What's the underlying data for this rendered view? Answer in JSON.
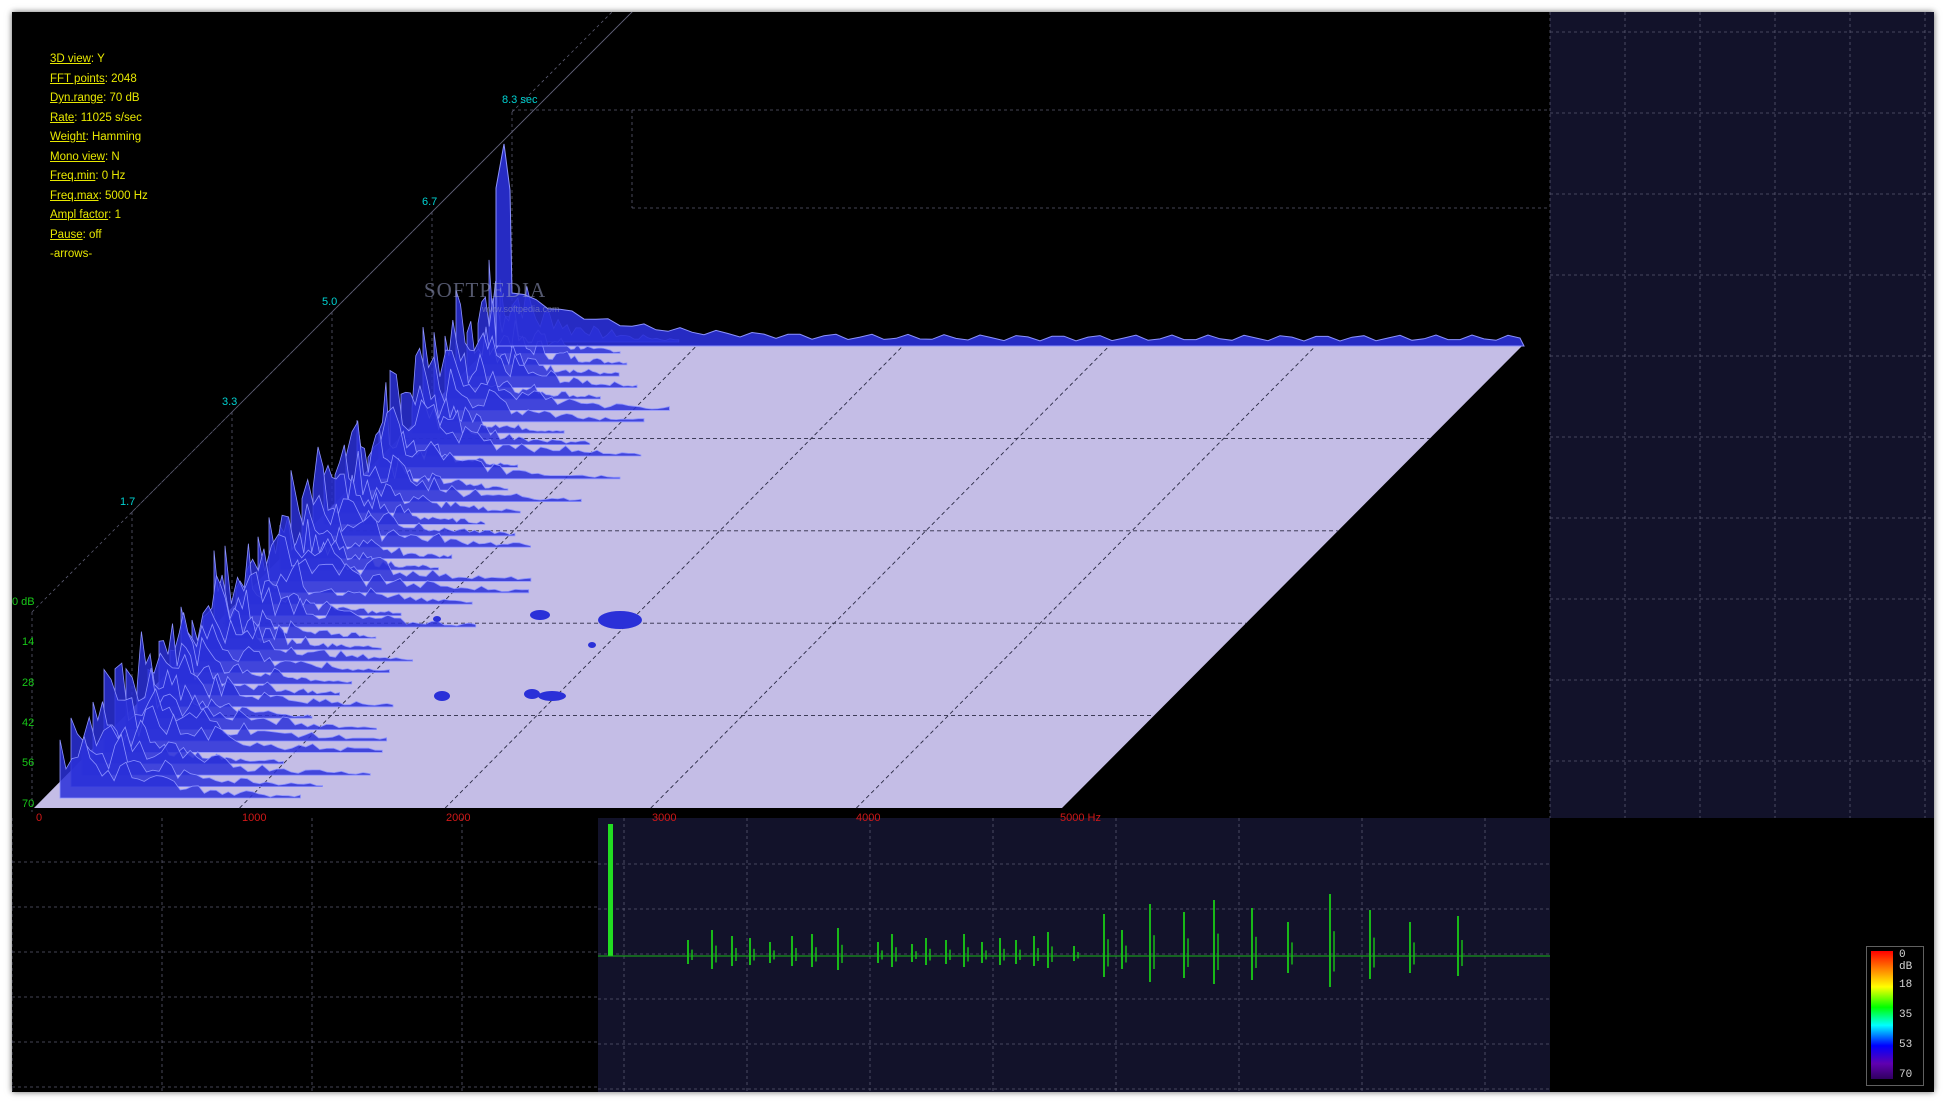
{
  "settings": [
    {
      "key": "3D view",
      "value": "Y"
    },
    {
      "key": "FFT points",
      "value": "2048"
    },
    {
      "key": "Dyn.range",
      "value": "70 dB"
    },
    {
      "key": "Rate",
      "value": "11025 s/sec"
    },
    {
      "key": "Weight",
      "value": "Hamming"
    },
    {
      "key": "Mono view",
      "value": "N"
    },
    {
      "key": "Freq.min",
      "value": "0 Hz"
    },
    {
      "key": "Freq.max",
      "value": "5000 Hz"
    },
    {
      "key": "Ampl factor",
      "value": "1"
    },
    {
      "key": "Pause",
      "value": "off"
    }
  ],
  "hint": "-arrows-",
  "time_axis": [
    "1.7",
    "3.3",
    "5.0",
    "6.7",
    "8.3 sec"
  ],
  "db_axis": [
    "0 dB",
    "14",
    "28",
    "42",
    "56",
    "70"
  ],
  "freq_axis": [
    "0",
    "1000",
    "2000",
    "3000",
    "4000",
    "5000 Hz"
  ],
  "watermark": {
    "main": "SOFTPEDIA",
    "sub": "www.softpedia.com"
  },
  "colorbar": {
    "labels": [
      "0 dB",
      "18",
      "35",
      "53",
      "70"
    ]
  },
  "colors": {
    "background": "#000000",
    "floor": "#c4bde6",
    "spectrum": "#2a30d8",
    "spectrum_light": "#8c92ff",
    "waveform": "#18b818",
    "cursor": "#22dd22",
    "panel": "#12122a",
    "grid": "#5a5a70"
  }
}
